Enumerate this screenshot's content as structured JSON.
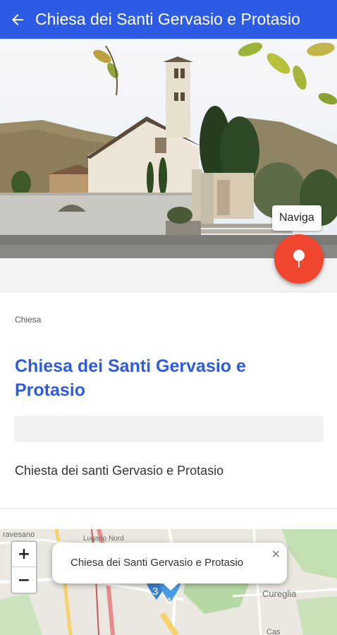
{
  "appbar": {
    "title": "Chiesa dei Santi Gervasio e Protasio",
    "back_icon": "arrow-left-icon",
    "background": "#2d5be3"
  },
  "hero": {
    "image": "church-photo",
    "naviga_label": "Naviga",
    "naviga_icon": "map-pin-icon",
    "fab_color": "#f0452f"
  },
  "poi": {
    "category": "Chiesa",
    "title": "Chiesa dei Santi Gervasio e Protasio",
    "description": "Chiesta dei santi Gervasio e Protasio",
    "title_color": "#2d5be3"
  },
  "map": {
    "labels": {
      "top_left": "ravesano",
      "top_center": "Lugano Nord",
      "right": "Cureglia",
      "bottom_right": "Cas"
    },
    "zoom_in": "+",
    "zoom_out": "−",
    "popup": {
      "text": "Chiesa dei Santi Gervasio e Protasio",
      "close": "×"
    },
    "clusters": [
      "3",
      "4"
    ]
  }
}
